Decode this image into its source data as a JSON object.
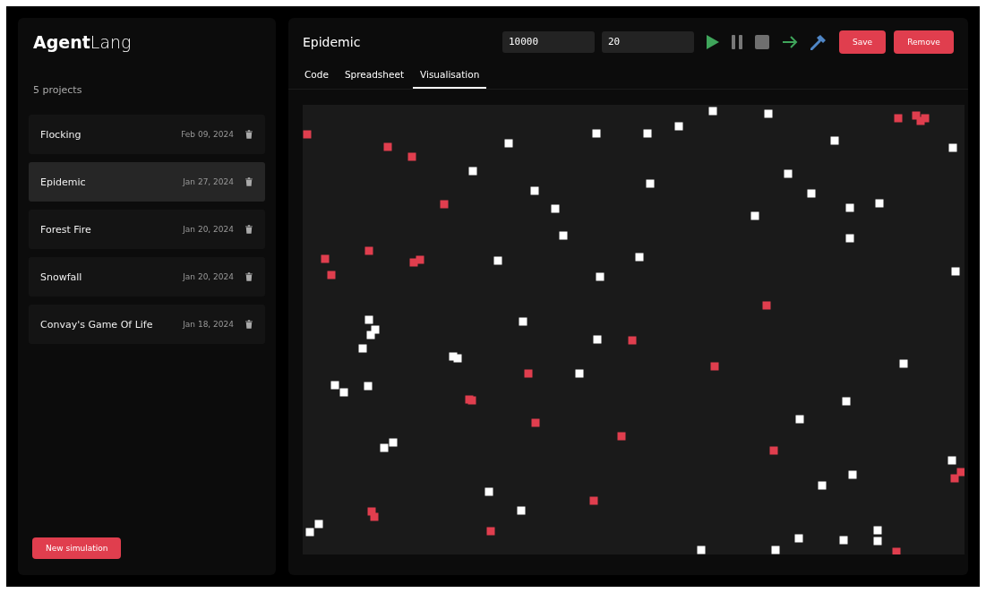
{
  "sidebar": {
    "logo_bold": "Agent",
    "logo_light": "Lang",
    "project_count": "5 projects",
    "projects": [
      {
        "name": "Flocking",
        "date": "Feb 09, 2024",
        "selected": false
      },
      {
        "name": "Epidemic",
        "date": "Jan 27, 2024",
        "selected": true
      },
      {
        "name": "Forest Fire",
        "date": "Jan 20, 2024",
        "selected": false
      },
      {
        "name": "Snowfall",
        "date": "Jan 20, 2024",
        "selected": false
      },
      {
        "name": "Convay's Game Of Life",
        "date": "Jan 18, 2024",
        "selected": false
      }
    ],
    "new_button": "New simulation"
  },
  "main": {
    "title": "Epidemic",
    "steps_value": "10000",
    "speed_value": "20",
    "save_button": "Save",
    "remove_button": "Remove",
    "tabs": [
      {
        "label": "Code",
        "selected": false
      },
      {
        "label": "Spreadsheet",
        "selected": false
      },
      {
        "label": "Visualisation",
        "selected": true
      }
    ]
  }
}
